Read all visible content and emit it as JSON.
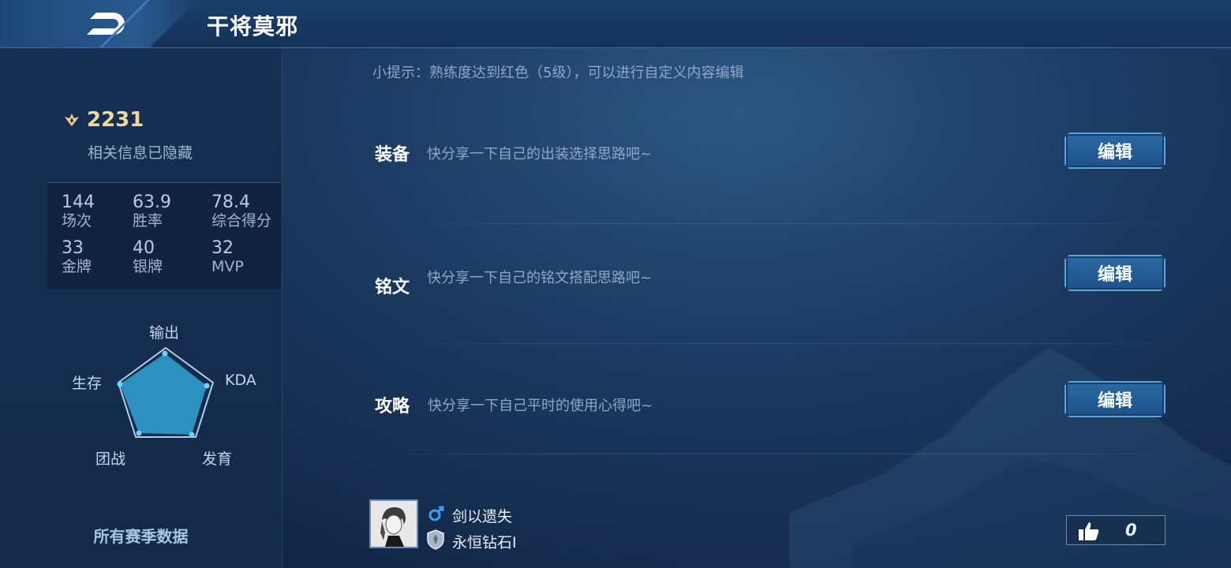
{
  "header": {
    "title": "干将莫邪"
  },
  "sidebar": {
    "score": "2231",
    "hidden_info": "相关信息已隐藏",
    "stats": [
      {
        "value": "144",
        "label": "场次"
      },
      {
        "value": "63.9",
        "label": "胜率"
      },
      {
        "value": "78.4",
        "label": "综合得分"
      },
      {
        "value": "33",
        "label": "金牌"
      },
      {
        "value": "40",
        "label": "银牌"
      },
      {
        "value": "32",
        "label": "MVP"
      }
    ],
    "radar": {
      "labels": [
        "输出",
        "KDA",
        "发育",
        "团战",
        "生存"
      ]
    },
    "all_season_label": "所有赛季数据"
  },
  "main": {
    "tip": "小提示：熟练度达到红色（5级），可以进行自定义内容编辑",
    "sections": [
      {
        "title": "装备",
        "desc": "快分享一下自己的出装选择思路吧~",
        "button": "编辑"
      },
      {
        "title": "铭文",
        "desc": "快分享一下自己的铭文搭配思路吧~",
        "button": "编辑"
      },
      {
        "title": "攻略",
        "desc": "快分享一下自己平时的使用心得吧~",
        "button": "编辑"
      }
    ],
    "user": {
      "name": "剑以遗失",
      "rank": "永恒钻石I"
    },
    "likes": "0"
  },
  "colors": {
    "accent": "#5aa3e0",
    "radar_fill": "#2f9ccc",
    "score_gold": "#f1d89a",
    "male_icon": "#3aa0e8"
  }
}
